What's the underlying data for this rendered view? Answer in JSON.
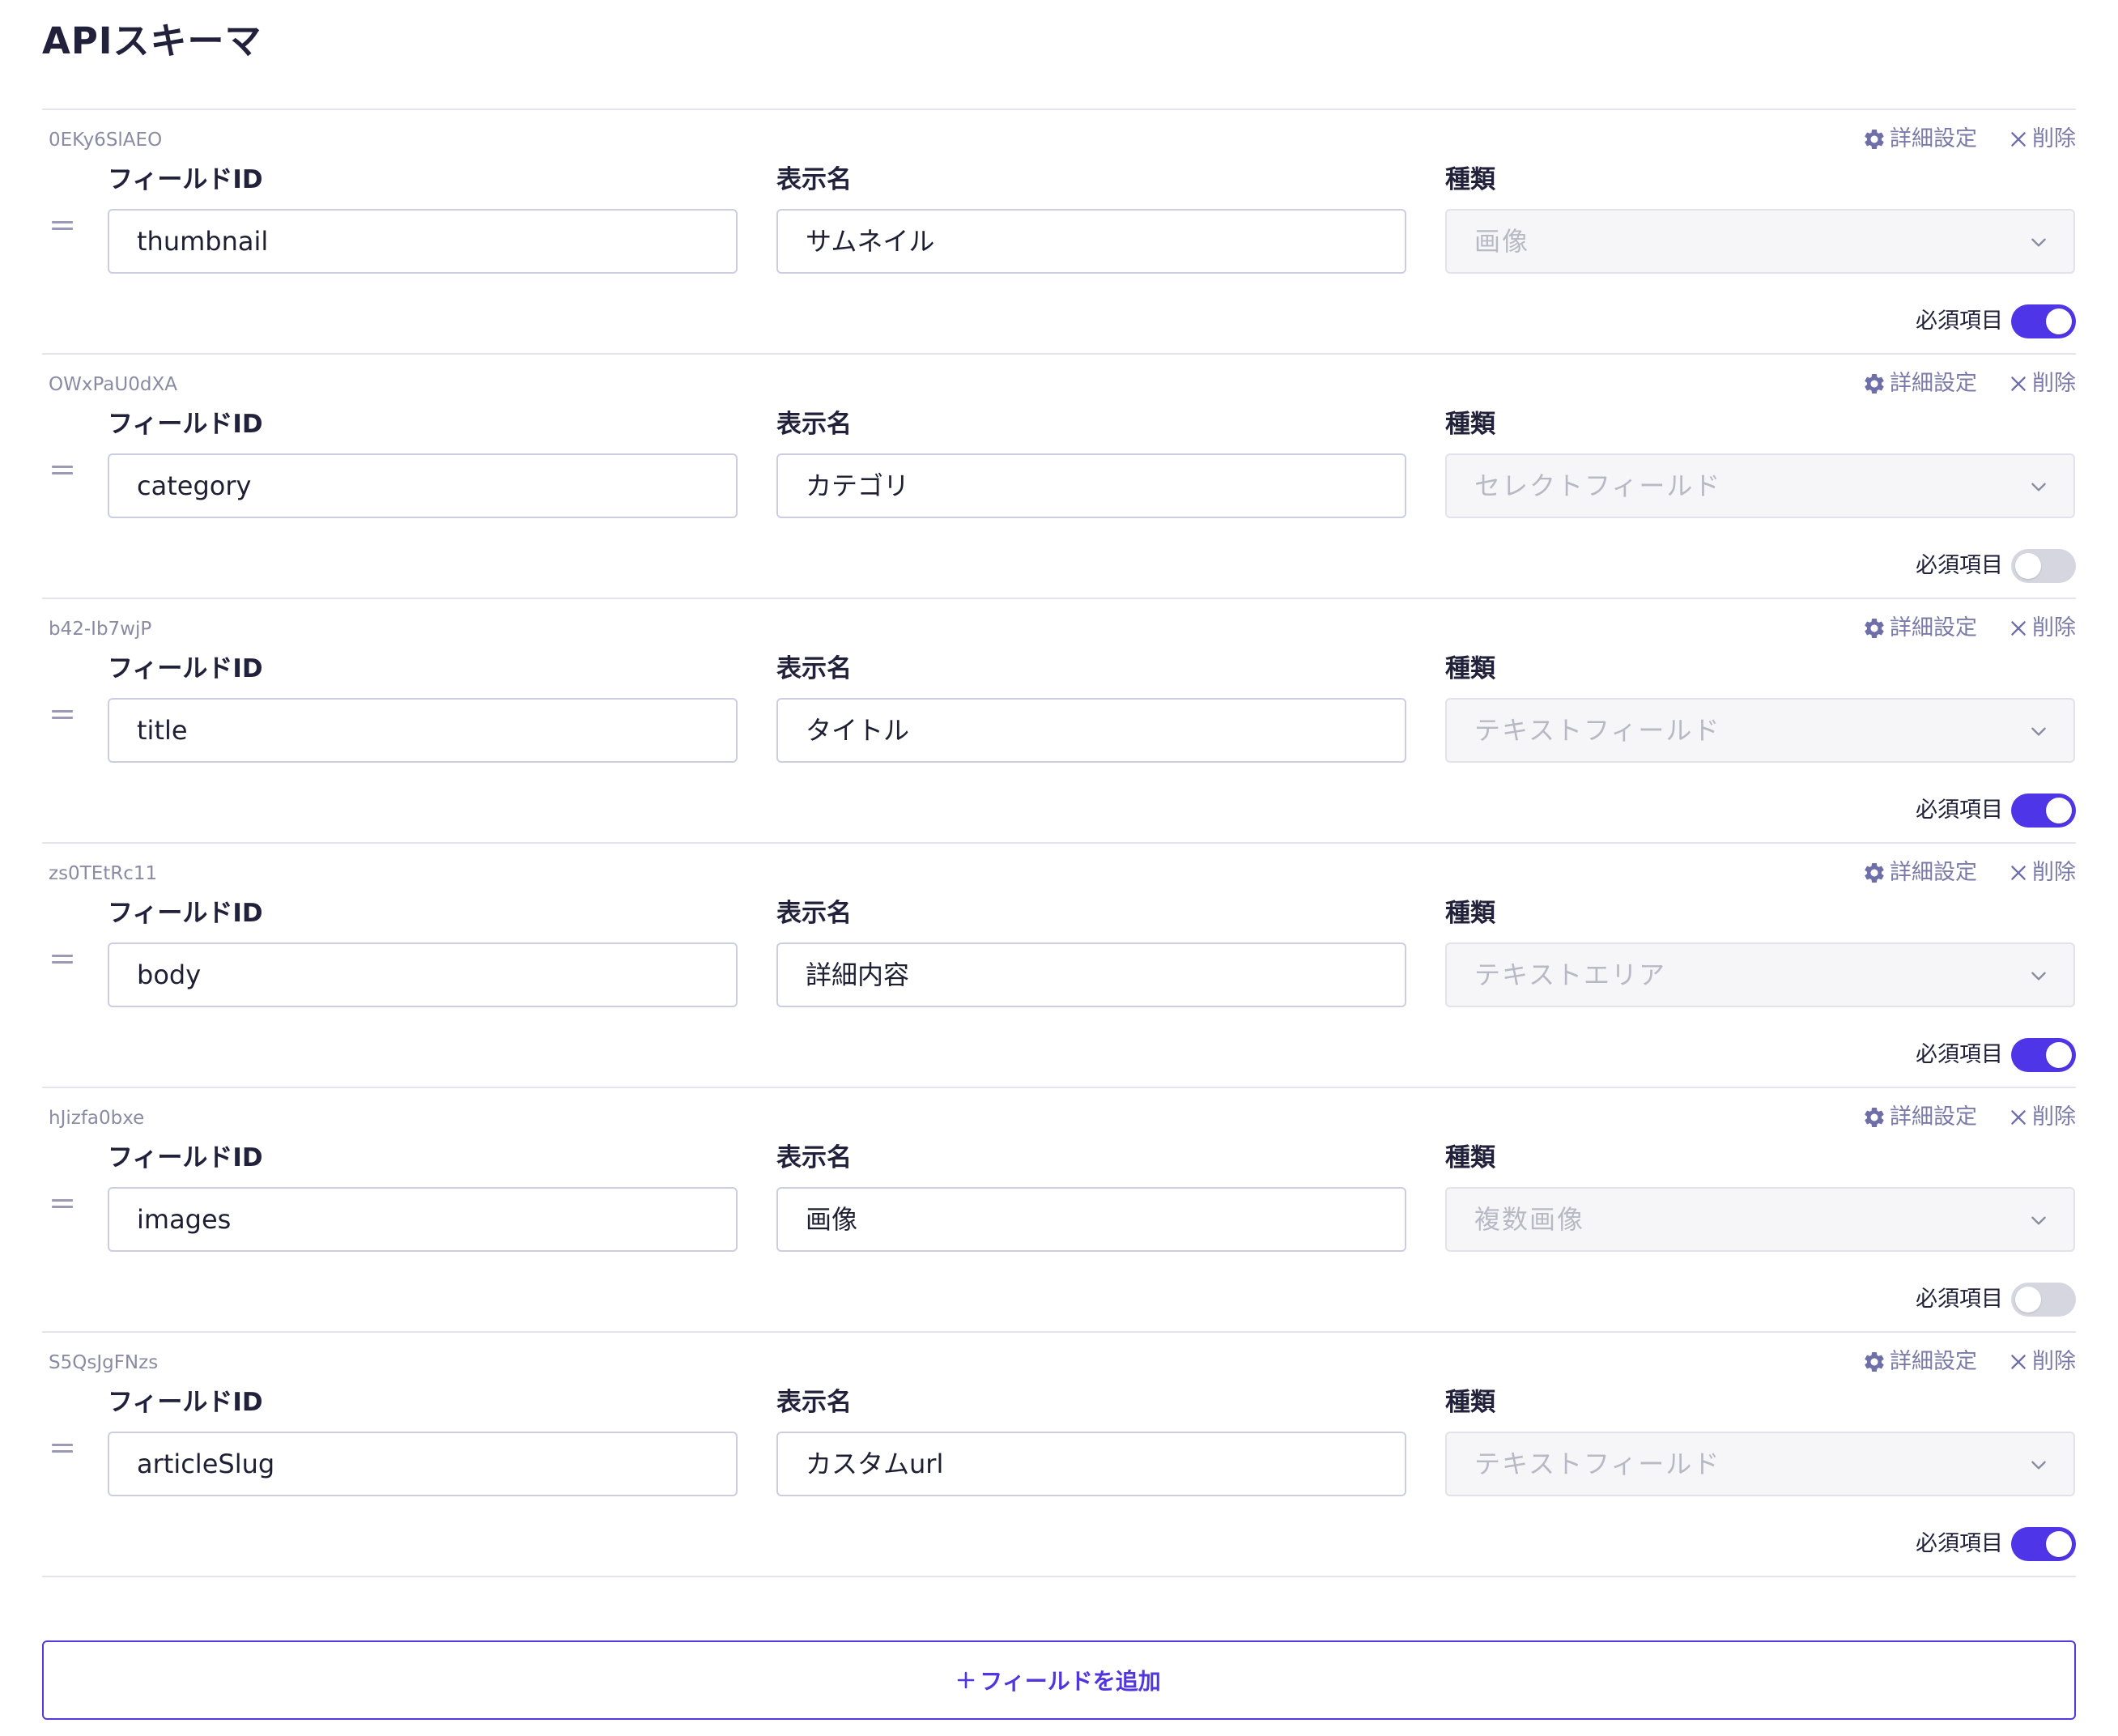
{
  "page_title": "APIスキーマ",
  "labels": {
    "field_id": "フィールドID",
    "display_name": "表示名",
    "type": "種類",
    "required": "必須項目",
    "settings": "詳細設定",
    "delete": "削除"
  },
  "fields": [
    {
      "key": "0EKy6SlAEO",
      "field_id": "thumbnail",
      "display_name": "サムネイル",
      "type": "画像",
      "required": true
    },
    {
      "key": "OWxPaU0dXA",
      "field_id": "category",
      "display_name": "カテゴリ",
      "type": "セレクトフィールド",
      "required": false
    },
    {
      "key": "b42-Ib7wjP",
      "field_id": "title",
      "display_name": "タイトル",
      "type": "テキストフィールド",
      "required": true
    },
    {
      "key": "zs0TEtRc11",
      "field_id": "body",
      "display_name": "詳細内容",
      "type": "テキストエリア",
      "required": true
    },
    {
      "key": "hJizfa0bxe",
      "field_id": "images",
      "display_name": "画像",
      "type": "複数画像",
      "required": false
    },
    {
      "key": "S5QsJgFNzs",
      "field_id": "articleSlug",
      "display_name": "カスタムurl",
      "type": "テキストフィールド",
      "required": true
    }
  ],
  "add_field_label": "フィールドを追加",
  "colors": {
    "accent": "#4f35e8",
    "toggle_off": "#d6d6e0",
    "action_text": "#7a7aa8",
    "select_placeholder": "#b9b9c6"
  },
  "icons": {
    "settings": "gear-icon",
    "delete": "close-icon",
    "drag": "drag-handle-icon",
    "select": "chevron-down-icon",
    "add": "plus-icon"
  }
}
